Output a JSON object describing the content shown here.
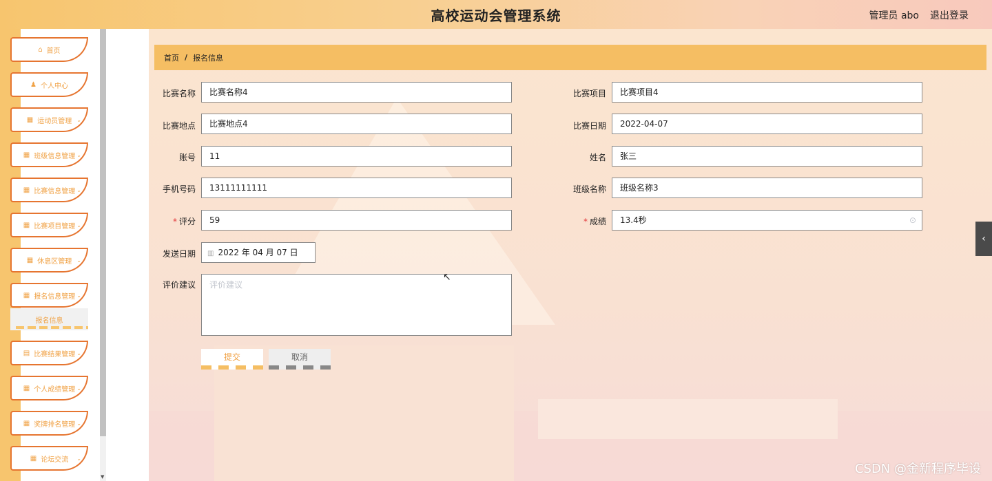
{
  "header": {
    "title": "高校运动会管理系统",
    "user_label": "管理员 abo",
    "logout_label": "退出登录"
  },
  "sidebar": {
    "items": [
      {
        "label": "首页",
        "icon": "home-icon",
        "glyph": "⌂"
      },
      {
        "label": "个人中心",
        "icon": "user-icon",
        "glyph": "♟"
      },
      {
        "label": "运动员管理",
        "icon": "grid-icon",
        "glyph": "▦"
      },
      {
        "label": "班级信息管理",
        "icon": "grid-icon",
        "glyph": "▦"
      },
      {
        "label": "比赛信息管理",
        "icon": "grid-icon",
        "glyph": "▦"
      },
      {
        "label": "比赛项目管理",
        "icon": "grid-icon",
        "glyph": "▦"
      },
      {
        "label": "休息区管理",
        "icon": "grid-icon",
        "glyph": "▦"
      },
      {
        "label": "报名信息管理",
        "icon": "grid-icon",
        "glyph": "▦"
      },
      {
        "label": "比赛结果管理",
        "icon": "clipboard-icon",
        "glyph": "▤"
      },
      {
        "label": "个人成绩管理",
        "icon": "table-icon",
        "glyph": "▦"
      },
      {
        "label": "奖牌排名管理",
        "icon": "grid-icon",
        "glyph": "▦"
      },
      {
        "label": "论坛交流",
        "icon": "grid-icon",
        "glyph": "▦"
      }
    ],
    "active_sub_label": "报名信息"
  },
  "breadcrumb": {
    "home": "首页",
    "separator": "/",
    "current": "报名信息"
  },
  "form": {
    "match_name": {
      "label": "比赛名称",
      "value": "比赛名称4"
    },
    "match_item": {
      "label": "比赛项目",
      "value": "比赛项目4"
    },
    "match_place": {
      "label": "比赛地点",
      "value": "比赛地点4"
    },
    "match_date": {
      "label": "比赛日期",
      "value": "2022-04-07"
    },
    "account": {
      "label": "账号",
      "value": "11"
    },
    "name": {
      "label": "姓名",
      "value": "张三"
    },
    "phone": {
      "label": "手机号码",
      "value": "13111111111"
    },
    "class_name": {
      "label": "班级名称",
      "value": "班级名称3"
    },
    "score": {
      "label": "评分",
      "value": "59",
      "required_mark": "*"
    },
    "result": {
      "label": "成绩",
      "value": "13.4秒",
      "required_mark": "*",
      "clear_icon": "⊙"
    },
    "send_date": {
      "label": "发送日期",
      "value": "2022 年 04 月 07 日",
      "calendar_glyph": "▥"
    },
    "comment": {
      "label": "评价建议",
      "placeholder": "评价建议"
    },
    "submit_label": "提交",
    "cancel_label": "取消"
  },
  "side_toggle": {
    "glyph": "‹"
  },
  "watermark": "CSDN @金新程序毕设",
  "colors": {
    "accent": "#f5be63",
    "sidebar_border": "#e67530",
    "sidebar_text": "#f0a246",
    "required": "#e4393c"
  }
}
